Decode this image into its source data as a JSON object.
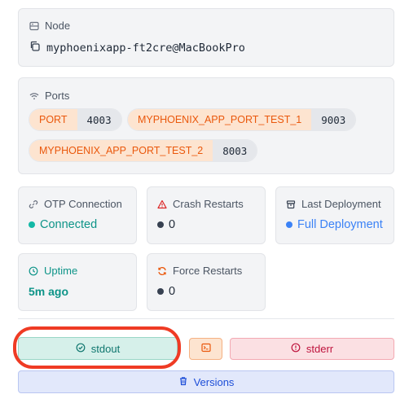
{
  "node": {
    "header": "Node",
    "header_icon": "server-icon",
    "value": "myphoenixapp-ft2cre@MacBookPro",
    "value_icon": "copy-icon"
  },
  "ports": {
    "header": "Ports",
    "header_icon": "wifi-icon",
    "items": [
      {
        "name": "PORT",
        "value": "4003"
      },
      {
        "name": "MYPHOENIX_APP_PORT_TEST_1",
        "value": "9003"
      },
      {
        "name": "MYPHOENIX_APP_PORT_TEST_2",
        "value": "8003"
      }
    ]
  },
  "stats": {
    "otp": {
      "label": "OTP Connection",
      "value": "Connected",
      "icon": "link-icon",
      "color": "#14b8a6"
    },
    "crash": {
      "label": "Crash Restarts",
      "value": "0",
      "icon": "warning-triangle-icon",
      "color": "#dc2626"
    },
    "deploy": {
      "label": "Last Deployment",
      "value": "Full Deployment",
      "icon": "package-icon",
      "color": "#3b82f6"
    },
    "uptime": {
      "label": "Uptime",
      "value": "5m ago",
      "icon": "clock-icon",
      "color": "#0d9488"
    },
    "force": {
      "label": "Force Restarts",
      "value": "0",
      "icon": "refresh-icon",
      "color": "#ea580c"
    }
  },
  "actions": {
    "stdout": {
      "label": "stdout",
      "icon": "check-circle-icon",
      "highlighted": true
    },
    "terminal": {
      "icon": "terminal-icon"
    },
    "stderr": {
      "label": "stderr",
      "icon": "alert-circle-icon"
    },
    "versions": {
      "label": "Versions",
      "icon": "trash-icon"
    }
  }
}
